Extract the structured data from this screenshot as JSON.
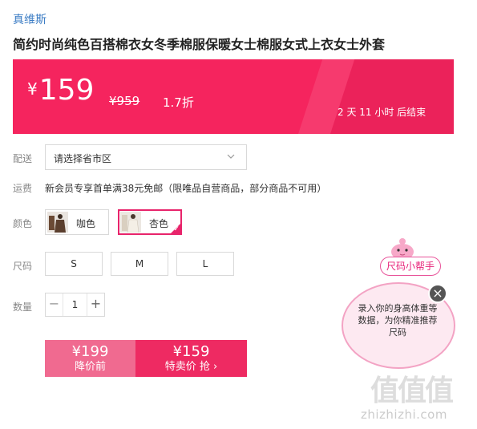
{
  "brand": "真维斯",
  "title": "简约时尚纯色百搭棉衣女冬季棉服保暖女士棉服女式上衣女士外套",
  "price": {
    "currency_symbol": "¥",
    "current": "159",
    "original": "¥959",
    "discount": "1.7折",
    "countdown": "2  天  11  小时  后结束"
  },
  "delivery": {
    "label": "配送",
    "value": "请选择省市区"
  },
  "shipping": {
    "label": "运费",
    "text": "新会员专享首单满38元免邮（限唯品自营商品，部分商品不可用）"
  },
  "color": {
    "label": "颜色",
    "options": [
      {
        "label": "咖色",
        "selected": false
      },
      {
        "label": "杏色",
        "selected": true
      }
    ]
  },
  "size": {
    "label": "尺码",
    "options": [
      "S",
      "M",
      "L"
    ]
  },
  "quantity": {
    "label": "数量",
    "value": "1",
    "minus": "−",
    "plus": "+"
  },
  "buttons": {
    "before_price": "¥199",
    "before_label": "降价前",
    "sale_price": "¥159",
    "sale_label": "特卖价 抢 ›"
  },
  "size_helper": {
    "tag": "尺码小帮手",
    "text": "录入你的身高体重等数据，为你精准推荐尺码",
    "close": "×"
  },
  "watermark": {
    "logo": "值值值",
    "url": "zhizhizhi.com"
  },
  "colors": {
    "accent": "#f5245e",
    "brand_link": "#3b7cc4",
    "sale_button": "#ee2a62",
    "before_button": "#f06a90"
  }
}
